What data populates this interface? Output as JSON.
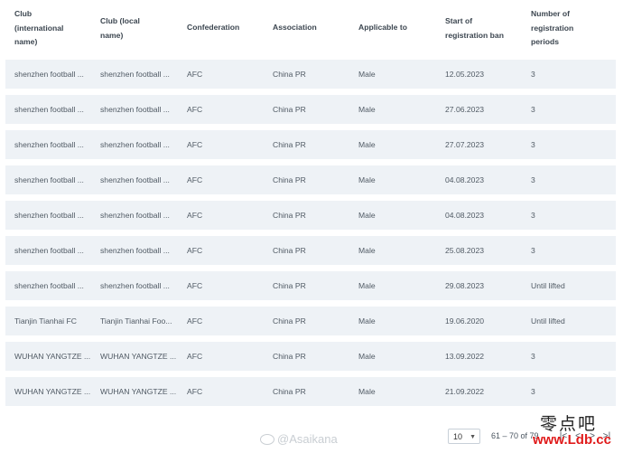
{
  "table": {
    "headers": [
      "Club\n(international\nname)",
      "Club (local\nname)",
      "Confederation",
      "Association",
      "Applicable to",
      "Start of\nregistration ban",
      "Number of\nregistration\nperiods"
    ],
    "rows": [
      [
        "shenzhen football ...",
        "shenzhen football ...",
        "AFC",
        "China PR",
        "Male",
        "12.05.2023",
        "3"
      ],
      [
        "shenzhen football ...",
        "shenzhen football ...",
        "AFC",
        "China PR",
        "Male",
        "27.06.2023",
        "3"
      ],
      [
        "shenzhen football ...",
        "shenzhen football ...",
        "AFC",
        "China PR",
        "Male",
        "27.07.2023",
        "3"
      ],
      [
        "shenzhen football ...",
        "shenzhen football ...",
        "AFC",
        "China PR",
        "Male",
        "04.08.2023",
        "3"
      ],
      [
        "shenzhen football ...",
        "shenzhen football ...",
        "AFC",
        "China PR",
        "Male",
        "04.08.2023",
        "3"
      ],
      [
        "shenzhen football ...",
        "shenzhen football ...",
        "AFC",
        "China PR",
        "Male",
        "25.08.2023",
        "3"
      ],
      [
        "shenzhen football ...",
        "shenzhen football ...",
        "AFC",
        "China PR",
        "Male",
        "29.08.2023",
        "Until lifted"
      ],
      [
        "Tianjin Tianhai FC",
        "Tianjin Tianhai Foo...",
        "AFC",
        "China PR",
        "Male",
        "19.06.2020",
        "Until lifted"
      ],
      [
        "WUHAN YANGTZE ...",
        "WUHAN YANGTZE ...",
        "AFC",
        "China PR",
        "Male",
        "13.09.2022",
        "3"
      ],
      [
        "WUHAN YANGTZE ...",
        "WUHAN YANGTZE ...",
        "AFC",
        "China PR",
        "Male",
        "21.09.2022",
        "3"
      ]
    ]
  },
  "pagination": {
    "page_size": "10",
    "range_text": "61 – 70 of 79",
    "first_icon": "first-page-icon",
    "prev_icon": "prev-page-icon",
    "next_icon": "next-page-icon",
    "last_icon": "last-page-icon"
  },
  "watermark": {
    "handle": "@Asaikana",
    "icon": "weibo-icon"
  },
  "site_badge": {
    "cn_text": "零点吧",
    "url": "www.Ldb.cc"
  },
  "colors": {
    "row_bg": "#eef2f6",
    "badge_red": "#e01b1b"
  }
}
